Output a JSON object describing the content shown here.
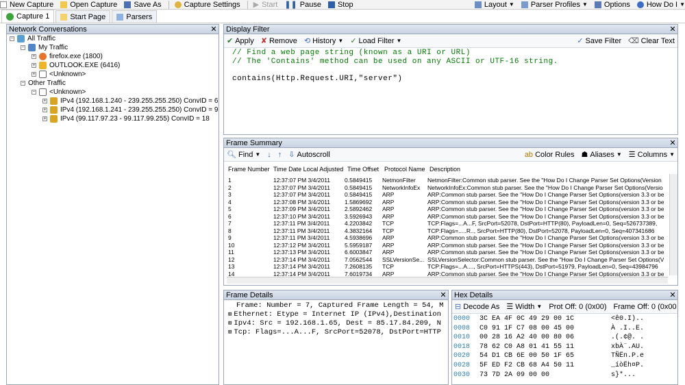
{
  "toolbar": {
    "new_capture": "New Capture",
    "open_capture": "Open Capture",
    "save_as": "Save As",
    "capture_settings": "Capture Settings",
    "start": "Start",
    "pause": "Pause",
    "stop": "Stop",
    "layout": "Layout",
    "parser_profiles": "Parser Profiles",
    "options": "Options",
    "how_do_i": "How Do I"
  },
  "tabs": [
    "Capture 1",
    "Start Page",
    "Parsers"
  ],
  "network_conversations": {
    "title": "Network Conversations",
    "all_traffic": "All Traffic",
    "my_traffic": "My Traffic",
    "firefox": "firefox.exe (1800)",
    "outlook": "OUTLOOK.EXE (6416)",
    "unknown1": "<Unknown>",
    "other_traffic": "Other Traffic",
    "unknown2": "<Unknown>",
    "conv1": "IPv4 (192.168.1.240 - 239.255.255.250) ConvID = 6",
    "conv2": "IPv4 (192.168.1.241 - 239.255.255.250) ConvID = 9",
    "conv3": "IPv4 (99.117.97.23 - 99.117.99.255) ConvID = 18"
  },
  "display_filter": {
    "title": "Display Filter",
    "apply": "Apply",
    "remove": "Remove",
    "history": "History",
    "load_filter": "Load Filter",
    "save_filter": "Save Filter",
    "clear_text": "Clear Text",
    "line1": "// Find a web page string (known as a URI or URL)",
    "line2": "// The 'Contains' method can be used on any ASCII or UTF-16 string.",
    "line3": "contains(Http.Request.URI,\"server\")"
  },
  "frame_summary": {
    "title": "Frame Summary",
    "find": "Find",
    "autoscroll": "Autoscroll",
    "color_rules": "Color Rules",
    "aliases": "Aliases",
    "columns": "Columns",
    "headers": [
      "Frame Number",
      "Time Date Local Adjusted",
      "Time Offset",
      "Protocol Name",
      "Description"
    ],
    "rows": [
      [
        "1",
        "12:37:07 PM 3/4/2011",
        "0.5849415",
        "NetmonFilter",
        "NetmonFilter:Common stub parser. See the \"How Do I Change Parser Set Options(Version"
      ],
      [
        "2",
        "12:37:07 PM 3/4/2011",
        "0.5849415",
        "NetworkInfoEx",
        "NetworkInfoEx:Common stub parser. See the \"How Do I Change Parser Set Options(Versio"
      ],
      [
        "3",
        "12:37:07 PM 3/4/2011",
        "0.5849415",
        "ARP",
        "ARP:Common stub parser. See the \"How Do I Change Parser Set Options(version 3.3 or be"
      ],
      [
        "4",
        "12:37:08 PM 3/4/2011",
        "1.5869692",
        "ARP",
        "ARP:Common stub parser. See the \"How Do I Change Parser Set Options(version 3.3 or be"
      ],
      [
        "5",
        "12:37:09 PM 3/4/2011",
        "2.5892462",
        "ARP",
        "ARP:Common stub parser. See the \"How Do I Change Parser Set Options(version 3.3 or be"
      ],
      [
        "6",
        "12:37:10 PM 3/4/2011",
        "3.5926943",
        "ARP",
        "ARP:Common stub parser. See the \"How Do I Change Parser Set Options(version 3.3 or be"
      ],
      [
        "7",
        "12:37:11 PM 3/4/2011",
        "4.2203842",
        "TCP",
        "TCP:Flags=...A...F, SrcPort=52078, DstPort=HTTP(80), PayloadLen=0, Seq=526737389,"
      ],
      [
        "8",
        "12:37:11 PM 3/4/2011",
        "4.3832164",
        "TCP",
        "TCP:Flags=.....R.., SrcPort=HTTP(80), DstPort=52078, PayloadLen=0, Seq=407341686"
      ],
      [
        "9",
        "12:37:11 PM 3/4/2011",
        "4.5938696",
        "ARP",
        "ARP:Common stub parser. See the \"How Do I Change Parser Set Options(version 3.3 or be"
      ],
      [
        "10",
        "12:37:12 PM 3/4/2011",
        "5.5959187",
        "ARP",
        "ARP:Common stub parser. See the \"How Do I Change Parser Set Options(version 3.3 or be"
      ],
      [
        "11",
        "12:37:13 PM 3/4/2011",
        "6.6003847",
        "ARP",
        "ARP:Common stub parser. See the \"How Do I Change Parser Set Options(version 3.3 or be"
      ],
      [
        "12",
        "12:37:14 PM 3/4/2011",
        "7.0562544",
        "SSLVersionSe...",
        "SSLVersionSelector:Common stub parser. See the \"How Do I Change Parser Set Options(V"
      ],
      [
        "13",
        "12:37:14 PM 3/4/2011",
        "7.2608135",
        "TCP",
        "TCP:Flags=...A...., SrcPort=HTTPS(443), DstPort=51979, PayloadLen=0, Seq=43984796"
      ],
      [
        "14",
        "12:37:14 PM 3/4/2011",
        "7.6019734",
        "ARP",
        "ARP:Common stub parser. See the \"How Do I Change Parser Set Options(version 3.3 or be"
      ]
    ]
  },
  "frame_details": {
    "title": "Frame Details",
    "line1": "Frame: Number = 7, Captured Frame Length = 54, M",
    "line2": "Ethernet: Etype = Internet IP (IPv4),Destination",
    "line3": "Ipv4: Src = 192.168.1.65, Dest = 85.17.84.209, N",
    "line4": "Tcp: Flags=...A...F, SrcPort=52078, DstPort=HTTP"
  },
  "hex_details": {
    "title": "Hex Details",
    "decode_as": "Decode As",
    "width": "Width",
    "prot_off": "Prot Off: 0 (0x00)",
    "frame_off": "Frame Off: 0 (0x00",
    "lines": [
      {
        "off": "0000",
        "hex": "3C EA 4F 0C 49 29 00 1C",
        "ascii": "<ê0.I)..",
        "off_d": "0000"
      },
      {
        "off": "0008",
        "hex": "C0 91 1F C7 08 00 45 00",
        "ascii": "À .I..E.",
        "off_d": "0008"
      },
      {
        "off": "0010",
        "hex": "00 28 16 A2 40 00 80 06",
        "ascii": ".(.¢@. .",
        "off_d": "0010"
      },
      {
        "off": "0018",
        "hex": "78 62 C0 A8 01 41 55 11",
        "ascii": "xbÀ¨.AU.",
        "off_d": "0018"
      },
      {
        "off": "0020",
        "hex": "54 D1 CB 6E 00 50 1F 65",
        "ascii": "TÑËn.P.e",
        "off_d": "0020"
      },
      {
        "off": "0028",
        "hex": "5F ED F2 CB 68 A4 50 11",
        "ascii": "_íòËh¤P.",
        "off_d": "0028"
      },
      {
        "off": "0030",
        "hex": "73 7D 2A 09 00 00",
        "ascii": "s}*...",
        "off_d": "0030"
      }
    ]
  }
}
